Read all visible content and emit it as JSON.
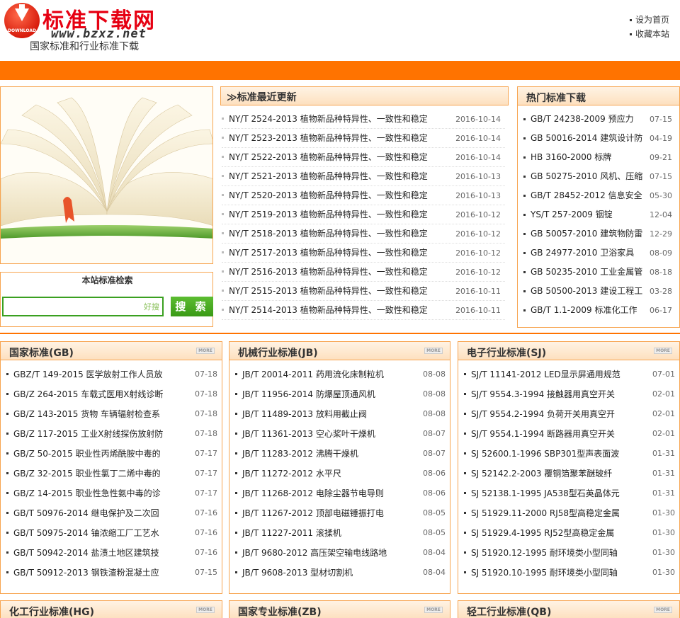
{
  "header": {
    "logo_badge_text": "DOWNLOAD",
    "site_name": "标准下载网",
    "site_url": "www.bzxz.net",
    "slogan": "国家标准和行业标准下载",
    "links": [
      "设为首页",
      "收藏本站"
    ]
  },
  "search": {
    "title": "本站标准检索",
    "placeholder_mark": "好搜",
    "button_label": "搜 索"
  },
  "latest": {
    "title": "≫标准最近更新",
    "items": [
      {
        "name": "NY/T 2524-2013 植物新品种特异性、一致性和稳定",
        "date": "2016-10-14"
      },
      {
        "name": "NY/T 2523-2013 植物新品种特异性、一致性和稳定",
        "date": "2016-10-14"
      },
      {
        "name": "NY/T 2522-2013 植物新品种特异性、一致性和稳定",
        "date": "2016-10-14"
      },
      {
        "name": "NY/T 2521-2013 植物新品种特异性、一致性和稳定",
        "date": "2016-10-13"
      },
      {
        "name": "NY/T 2520-2013 植物新品种特异性、一致性和稳定",
        "date": "2016-10-13"
      },
      {
        "name": "NY/T 2519-2013 植物新品种特异性、一致性和稳定",
        "date": "2016-10-12"
      },
      {
        "name": "NY/T 2518-2013 植物新品种特异性、一致性和稳定",
        "date": "2016-10-12"
      },
      {
        "name": "NY/T 2517-2013 植物新品种特异性、一致性和稳定",
        "date": "2016-10-12"
      },
      {
        "name": "NY/T 2516-2013 植物新品种特异性、一致性和稳定",
        "date": "2016-10-12"
      },
      {
        "name": "NY/T 2515-2013 植物新品种特异性、一致性和稳定",
        "date": "2016-10-11"
      },
      {
        "name": "NY/T 2514-2013 植物新品种特异性、一致性和稳定",
        "date": "2016-10-11"
      }
    ]
  },
  "hot": {
    "title": "热门标准下载",
    "items": [
      {
        "name": "GB/T 24238-2009 预应力",
        "date": "07-15"
      },
      {
        "name": "GB 50016-2014 建筑设计防",
        "date": "04-19"
      },
      {
        "name": "HB 3160-2000 标牌",
        "date": "09-21"
      },
      {
        "name": "GB 50275-2010 风机、压缩",
        "date": "07-15"
      },
      {
        "name": "GB/T 28452-2012 信息安全",
        "date": "05-30"
      },
      {
        "name": "YS/T 257-2009 铟锭",
        "date": "12-04"
      },
      {
        "name": "GB 50057-2010 建筑物防雷",
        "date": "12-29"
      },
      {
        "name": "GB 24977-2010 卫浴家具",
        "date": "08-09"
      },
      {
        "name": "GB 50235-2010 工业金属管",
        "date": "08-18"
      },
      {
        "name": "GB 50500-2013 建设工程工",
        "date": "03-28"
      },
      {
        "name": "GB/T 1.1-2009 标准化工作",
        "date": "06-17"
      }
    ]
  },
  "more_label": "MORE",
  "sections": [
    {
      "title": "国家标准(GB)",
      "items": [
        {
          "name": "GBZ/T 149-2015 医学放射工作人员放",
          "date": "07-18"
        },
        {
          "name": "GB/Z 264-2015 车载式医用X射线诊断",
          "date": "07-18"
        },
        {
          "name": "GB/Z 143-2015 货物 车辆辐射检查系",
          "date": "07-18"
        },
        {
          "name": "GB/Z 117-2015 工业X射线探伤放射防",
          "date": "07-18"
        },
        {
          "name": "GB/Z 50-2015 职业性丙烯酰胺中毒的",
          "date": "07-17"
        },
        {
          "name": "GB/Z 32-2015 职业性氯丁二烯中毒的",
          "date": "07-17"
        },
        {
          "name": "GB/Z 14-2015 职业性急性氨中毒的诊",
          "date": "07-17"
        },
        {
          "name": "GB/T 50976-2014 继电保护及二次回",
          "date": "07-16"
        },
        {
          "name": "GB/T 50975-2014 铀浓缩工厂工艺水",
          "date": "07-16"
        },
        {
          "name": "GB/T 50942-2014 盐渍土地区建筑技",
          "date": "07-16"
        },
        {
          "name": "GB/T 50912-2013 钢铁渣粉混凝土应",
          "date": "07-15"
        }
      ]
    },
    {
      "title": "机械行业标准(JB)",
      "items": [
        {
          "name": "JB/T 20014-2011 药用流化床制粒机",
          "date": "08-08"
        },
        {
          "name": "JB/T 11956-2014 防爆屋顶通风机",
          "date": "08-08"
        },
        {
          "name": "JB/T 11489-2013 放料用截止阀",
          "date": "08-08"
        },
        {
          "name": "JB/T 11361-2013 空心桨叶干燥机",
          "date": "08-07"
        },
        {
          "name": "JB/T 11283-2012 沸腾干燥机",
          "date": "08-07"
        },
        {
          "name": "JB/T 11272-2012 水平尺",
          "date": "08-06"
        },
        {
          "name": "JB/T 11268-2012 电除尘器节电导则",
          "date": "08-06"
        },
        {
          "name": "JB/T 11267-2012 顶部电磁锤振打电",
          "date": "08-05"
        },
        {
          "name": "JB/T 11227-2011 滚揉机",
          "date": "08-05"
        },
        {
          "name": "JB/T 9680-2012 高压架空输电线路地",
          "date": "08-04"
        },
        {
          "name": "JB/T 9608-2013 型材切割机",
          "date": "08-04"
        }
      ]
    },
    {
      "title": "电子行业标准(SJ)",
      "items": [
        {
          "name": "SJ/T 11141-2012 LED显示屏通用规范",
          "date": "07-01"
        },
        {
          "name": "SJ/T 9554.3-1994 接触器用真空开关",
          "date": "02-01"
        },
        {
          "name": "SJ/T 9554.2-1994 负荷开关用真空开",
          "date": "02-01"
        },
        {
          "name": "SJ/T 9554.1-1994 断路器用真空开关",
          "date": "02-01"
        },
        {
          "name": "SJ 52600.1-1996 SBP301型声表面波",
          "date": "01-31"
        },
        {
          "name": "SJ 52142.2-2003 覆铜箔聚苯醚玻纤",
          "date": "01-31"
        },
        {
          "name": "SJ 52138.1-1995 JA538型石英晶体元",
          "date": "01-31"
        },
        {
          "name": "SJ 51929.11-2000 RJ58型高稳定金属",
          "date": "01-30"
        },
        {
          "name": "SJ 51929.4-1995 RJ52型高稳定金属",
          "date": "01-30"
        },
        {
          "name": "SJ 51920.12-1995 耐环境类小型同轴",
          "date": "01-30"
        },
        {
          "name": "SJ 51920.10-1995 耐环境类小型同轴",
          "date": "01-30"
        }
      ]
    }
  ],
  "bottom_sections": [
    "化工行业标准(HG)",
    "国家专业标准(ZB)",
    "轻工行业标准(QB)"
  ]
}
